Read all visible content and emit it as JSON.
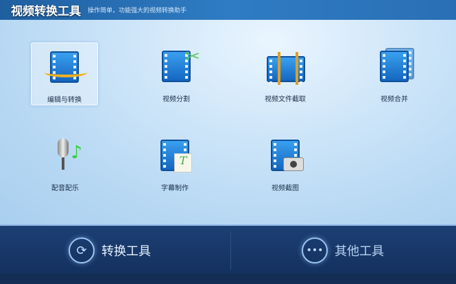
{
  "header": {
    "title": "视频转换工具",
    "subtitle": "操作简单，功能强大的视频转换助手"
  },
  "tools": [
    {
      "label": "编辑与转换",
      "icon": "edit-convert-icon"
    },
    {
      "label": "视频分割",
      "icon": "scissors-film-icon"
    },
    {
      "label": "视频文件截取",
      "icon": "film-clip-icon"
    },
    {
      "label": "视频合并",
      "icon": "film-merge-icon"
    },
    {
      "label": "配音配乐",
      "icon": "microphone-music-icon"
    },
    {
      "label": "字幕制作",
      "icon": "subtitle-icon"
    },
    {
      "label": "视频截图",
      "icon": "camera-film-icon"
    }
  ],
  "bottom": {
    "convert": "转换工具",
    "other": "其他工具"
  }
}
